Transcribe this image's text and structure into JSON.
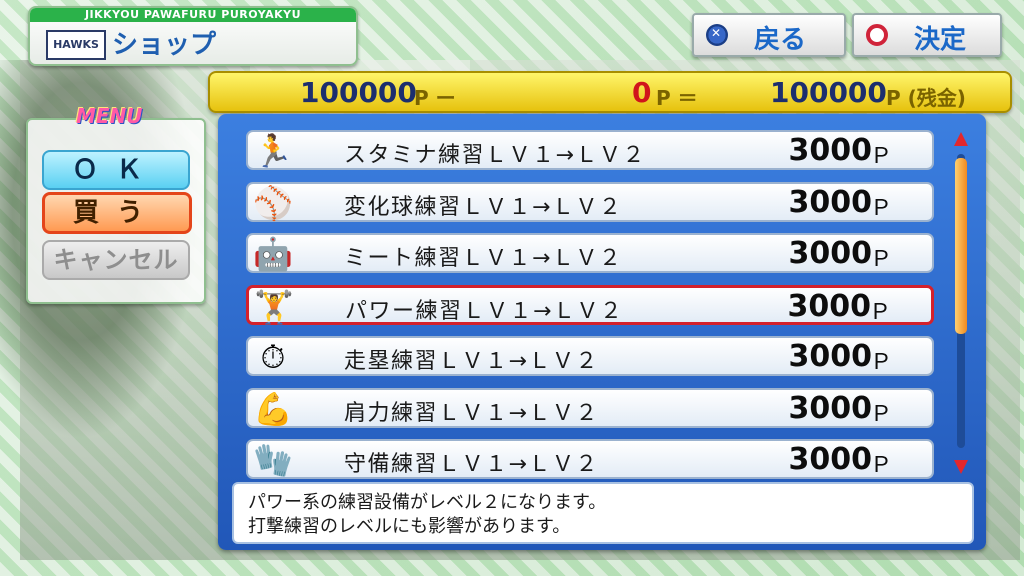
{
  "header": {
    "brand": "JIKKYOU PAWAFURU PUROYAKYU",
    "logo": "HAWKS",
    "title": "ショップ"
  },
  "top_buttons": {
    "back_label": "戻る",
    "confirm_label": "決定"
  },
  "points": {
    "balance": "100000",
    "balance_unit": "P ー",
    "cost": "0",
    "cost_unit": "P ＝",
    "remaining": "100000",
    "remaining_unit": "P (残金)"
  },
  "menu": {
    "title": "MENU",
    "ok": "ＯＫ",
    "buy": "買う",
    "cancel": "キャンセル"
  },
  "items": [
    {
      "icon": "treadmill-icon",
      "glyph": "🏃",
      "name": "スタミナ練習ＬＶ１→ＬＶ２",
      "price": "3000",
      "unit": "Ｐ"
    },
    {
      "icon": "baseball-icon",
      "glyph": "⚾",
      "name": "変化球練習ＬＶ１→ＬＶ２",
      "price": "3000",
      "unit": "Ｐ"
    },
    {
      "icon": "pitching-machine-icon",
      "glyph": "🤖",
      "name": "ミート練習ＬＶ１→ＬＶ２",
      "price": "3000",
      "unit": "Ｐ"
    },
    {
      "icon": "weight-bench-icon",
      "glyph": "🏋",
      "name": "パワー練習ＬＶ１→ＬＶ２",
      "price": "3000",
      "unit": "Ｐ"
    },
    {
      "icon": "speed-plate-icon",
      "glyph": "⏱",
      "name": "走塁練習ＬＶ１→ＬＶ２",
      "price": "3000",
      "unit": "Ｐ"
    },
    {
      "icon": "arm-machine-icon",
      "glyph": "💪",
      "name": "肩力練習ＬＶ１→ＬＶ２",
      "price": "3000",
      "unit": "Ｐ"
    },
    {
      "icon": "glove-icon",
      "glyph": "🧤",
      "name": "守備練習ＬＶ１→ＬＶ２",
      "price": "3000",
      "unit": "Ｐ"
    }
  ],
  "selected_index": 3,
  "description": {
    "line1": "パワー系の練習設備がレベル２になります。",
    "line2": "打撃練習のレベルにも影響があります。"
  }
}
